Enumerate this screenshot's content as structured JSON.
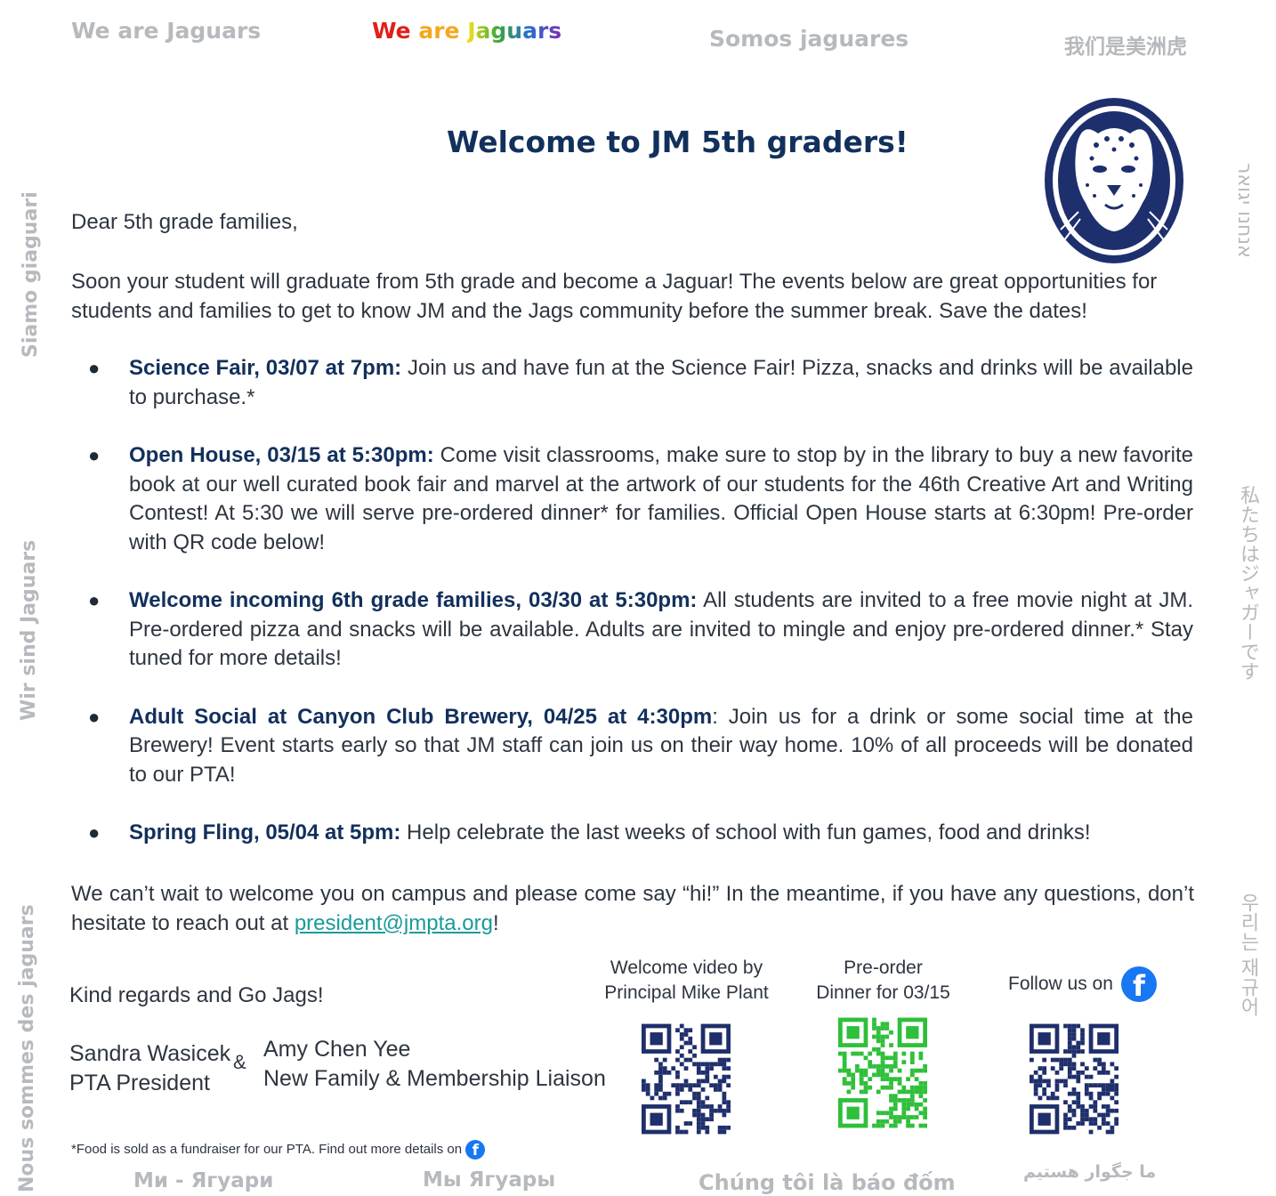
{
  "top_languages": {
    "english": "We are Jaguars",
    "rainbow": [
      "We ",
      "are ",
      "Jaguars"
    ],
    "spanish": "Somos jaguares",
    "chinese": "我们是美洲虎"
  },
  "side_languages": {
    "italian": "Siamo giaguari",
    "german": "Wir sind Jaguars",
    "french": "Nous sommes des jaguars",
    "hebrew": "אנחנו יגואר",
    "japanese": "私たちはジャガーです",
    "korean": "우리는 재규어"
  },
  "bottom_languages": {
    "ukrainian": "Ми - Ягуари",
    "russian": "Мы Ягуары",
    "vietnamese": "Chúng tôi là báo đốm",
    "persian": "ما جگوار هستیم"
  },
  "title": "Welcome to JM 5th graders!",
  "greeting": "Dear 5th grade families,",
  "intro": "Soon your student will graduate from 5th grade and become a Jaguar! The events below are great opportunities for students and families to get to know JM and the Jags community before the summer break. Save the dates!",
  "events": [
    {
      "heading": "Science Fair, 03/07 at 7pm:",
      "text": " Join us and have fun at the Science Fair! Pizza, snacks and drinks will be available to purchase.*"
    },
    {
      "heading": "Open House, 03/15 at 5:30pm:",
      "text": " Come visit classrooms, make sure to stop by in the library to buy a new favorite book at our well curated book fair and marvel at the artwork of our students for the 46th Creative Art and Writing Contest! At 5:30 we will serve pre-ordered dinner* for families. Official Open House starts at 6:30pm! Pre-order with QR code below!"
    },
    {
      "heading": "Welcome incoming 6th grade families, 03/30 at 5:30pm:",
      "text": " All students are invited to a free movie night at JM. Pre-ordered pizza and snacks will be available. Adults are invited to mingle and enjoy pre-ordered dinner.* Stay tuned for more details!"
    },
    {
      "heading": "Adult Social at Canyon Club Brewery, 04/25 at 4:30pm",
      "text": ": Join us for a drink or some social time at the Brewery! Event starts early so that JM staff can join us on their way home. 10% of all proceeds will be donated to our PTA!"
    },
    {
      "heading": "Spring Fling, 05/04 at 5pm:",
      "text": " Help celebrate the last weeks of school with fun games, food and drinks!"
    }
  ],
  "closing": {
    "before_email": "We can’t wait to welcome you on campus and please come say “hi!” In the meantime, if you have any questions, don’t hesitate to reach out at ",
    "email": "president@jmpta.org",
    "after_email": "!"
  },
  "signoff": "Kind regards and Go Jags!",
  "signers": {
    "name1": "Sandra Wasicek",
    "role1": "PTA President",
    "amp": "&",
    "name2": "Amy Chen Yee",
    "role2": "New Family & Membership Liaison"
  },
  "qr_codes": [
    {
      "line1": "Welcome video by",
      "line2": "Principal Mike Plant",
      "color": "#1f2f6b"
    },
    {
      "line1": "Pre-order",
      "line2": "Dinner for 03/15",
      "color": "#2fbf3a"
    },
    {
      "label": "Follow us on",
      "icon": "facebook-icon",
      "color": "#1f2f6b"
    }
  ],
  "footnote": "*Food is sold as a fundraiser for our PTA. Find out more details on",
  "colors": {
    "navy": "#12305c",
    "link": "#1a9a9a",
    "facebook": "#1877f2"
  }
}
